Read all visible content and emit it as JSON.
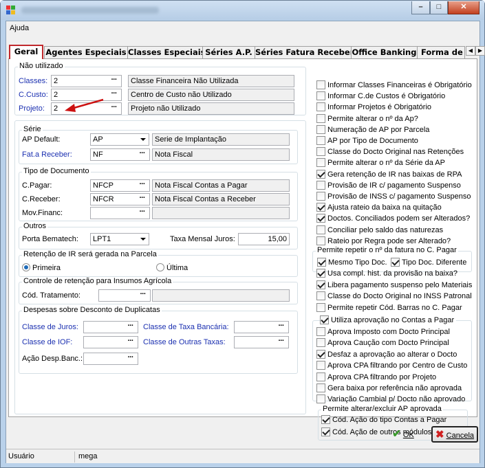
{
  "window": {
    "minimize": "–",
    "maximize": "□",
    "close": "✕"
  },
  "menu": {
    "help": "Ajuda"
  },
  "tabs": [
    "Geral",
    "Agentes Especiais",
    "Classes Especiais",
    "Séries A.P.",
    "Séries Fatura Receber",
    "Office Banking",
    "Forma de"
  ],
  "nao_utilizado": {
    "title": "Não utilizado",
    "classes": {
      "label": "Classes:",
      "value": "2",
      "desc": "Classe Financeira Não Utilizada"
    },
    "ccusto": {
      "label": "C.Custo:",
      "value": "2",
      "desc": "Centro de Custo não Utilizado"
    },
    "projeto": {
      "label": "Projeto:",
      "value": "2",
      "desc": "Projeto não Utilizado"
    }
  },
  "serie": {
    "title": "Série",
    "ap_default": {
      "label": "AP Default:",
      "value": "AP",
      "desc": "Serie de Implantação"
    },
    "fat_receber": {
      "label": "Fat.a Receber:",
      "value": "NF",
      "desc": "Nota Fiscal"
    }
  },
  "tipo_doc": {
    "title": "Tipo de Documento",
    "cpagar": {
      "label": "C.Pagar:",
      "value": "NFCP",
      "desc": "Nota Fiscal Contas a Pagar"
    },
    "creceber": {
      "label": "C.Receber:",
      "value": "NFCR",
      "desc": "Nota Fiscal Contas a Receber"
    },
    "movfinanc": {
      "label": "Mov.Financ:",
      "value": "",
      "desc": ""
    }
  },
  "outros": {
    "title": "Outros",
    "porta_label": "Porta Bematech:",
    "porta_value": "LPT1",
    "taxa_label": "Taxa Mensal Juros:",
    "taxa_value": "15,00"
  },
  "retencao_ir": {
    "title": "Retenção de IR será gerada na Parcela",
    "primeira": "Primeira",
    "ultima": "Última",
    "selected": "Primeira"
  },
  "insumos": {
    "title": "Controle de retenção para Insumos Agrícola",
    "cod_label": "Cód. Tratamento:"
  },
  "despesas": {
    "title": "Despesas sobre Desconto de Duplicatas",
    "juros": "Classe de Juros:",
    "taxa_bancaria": "Classe de Taxa Bancária:",
    "iof": "Classe de IOF:",
    "outras_taxas": "Classe de Outras Taxas:",
    "acao_desp": "Ação Desp.Banc.:"
  },
  "checks": [
    {
      "label": "Informar Classes Financeiras é Obrigatório",
      "checked": false
    },
    {
      "label": "Informar C.de Custos é Obrigatório",
      "checked": false
    },
    {
      "label": "Informar Projetos é Obrigatório",
      "checked": false
    },
    {
      "label": "Permite alterar o nº da Ap?",
      "checked": false
    },
    {
      "label": "Numeração de AP por Parcela",
      "checked": false
    },
    {
      "label": "AP por Tipo de Documento",
      "checked": false
    },
    {
      "label": "Classe do Docto Original nas Retenções",
      "checked": false
    },
    {
      "label": "Permite alterar o nº da Série da AP",
      "checked": false
    },
    {
      "label": "Gera retenção de IR nas baixas de RPA",
      "checked": true
    },
    {
      "label": "Provisão de IR c/ pagamento Suspenso",
      "checked": false
    },
    {
      "label": "Provisão de INSS c/ pagamento Suspenso",
      "checked": false
    },
    {
      "label": "Ajusta rateio da baixa na quitação",
      "checked": true
    },
    {
      "label": "Doctos. Conciliados podem ser Alterados?",
      "checked": true
    },
    {
      "label": "Conciliar pelo saldo das naturezas",
      "checked": false
    },
    {
      "label": "Rateio por Regra pode ser Alterado?",
      "checked": false
    }
  ],
  "repetir": {
    "title": "Permite repetir o nº da fatura no C. Pagar",
    "mesmo": "Mesmo Tipo Doc.",
    "diferente": "Tipo Doc. Diferente"
  },
  "checks2": [
    {
      "label": "Usa compl. hist. da provisão na baixa?",
      "checked": true
    },
    {
      "label": "Libera pagamento suspenso pelo Materiais",
      "checked": true
    },
    {
      "label": "Classe do Docto Original no INSS Patronal",
      "checked": false
    }
  ],
  "barras": "Permite repetir Cód. Barras no C. Pagar",
  "aprovacao": {
    "title": "Utiliza aprovação no Contas a Pagar",
    "items": [
      {
        "label": "Aprova Imposto com Docto Principal",
        "checked": false
      },
      {
        "label": "Aprova Caução com Docto Principal",
        "checked": false
      },
      {
        "label": "Desfaz a aprovação ao alterar o Docto",
        "checked": true
      },
      {
        "label": "Aprova CPA filtrando por Centro de Custo",
        "checked": false
      },
      {
        "label": "Aprova CPA filtrando por Projeto",
        "checked": false
      },
      {
        "label": "Gera baixa por referência não aprovada",
        "checked": false
      },
      {
        "label": "Variação Cambial p/ Docto não aprovado",
        "checked": false
      }
    ]
  },
  "alterar_ap": {
    "title": "Permite alterar/excluir AP aprovada",
    "tipo": "Cód. Ação do tipo Contas a Pagar",
    "outros": "Cód. Ação de outros módulos"
  },
  "buttons": {
    "ok": "OK",
    "cancel": "Cancela"
  },
  "status": {
    "label": "Usuário",
    "user": "mega"
  },
  "colors": {
    "accent_red": "#c0282c",
    "link_blue": "#1a2fb0",
    "arrow_red": "#cc1010"
  }
}
